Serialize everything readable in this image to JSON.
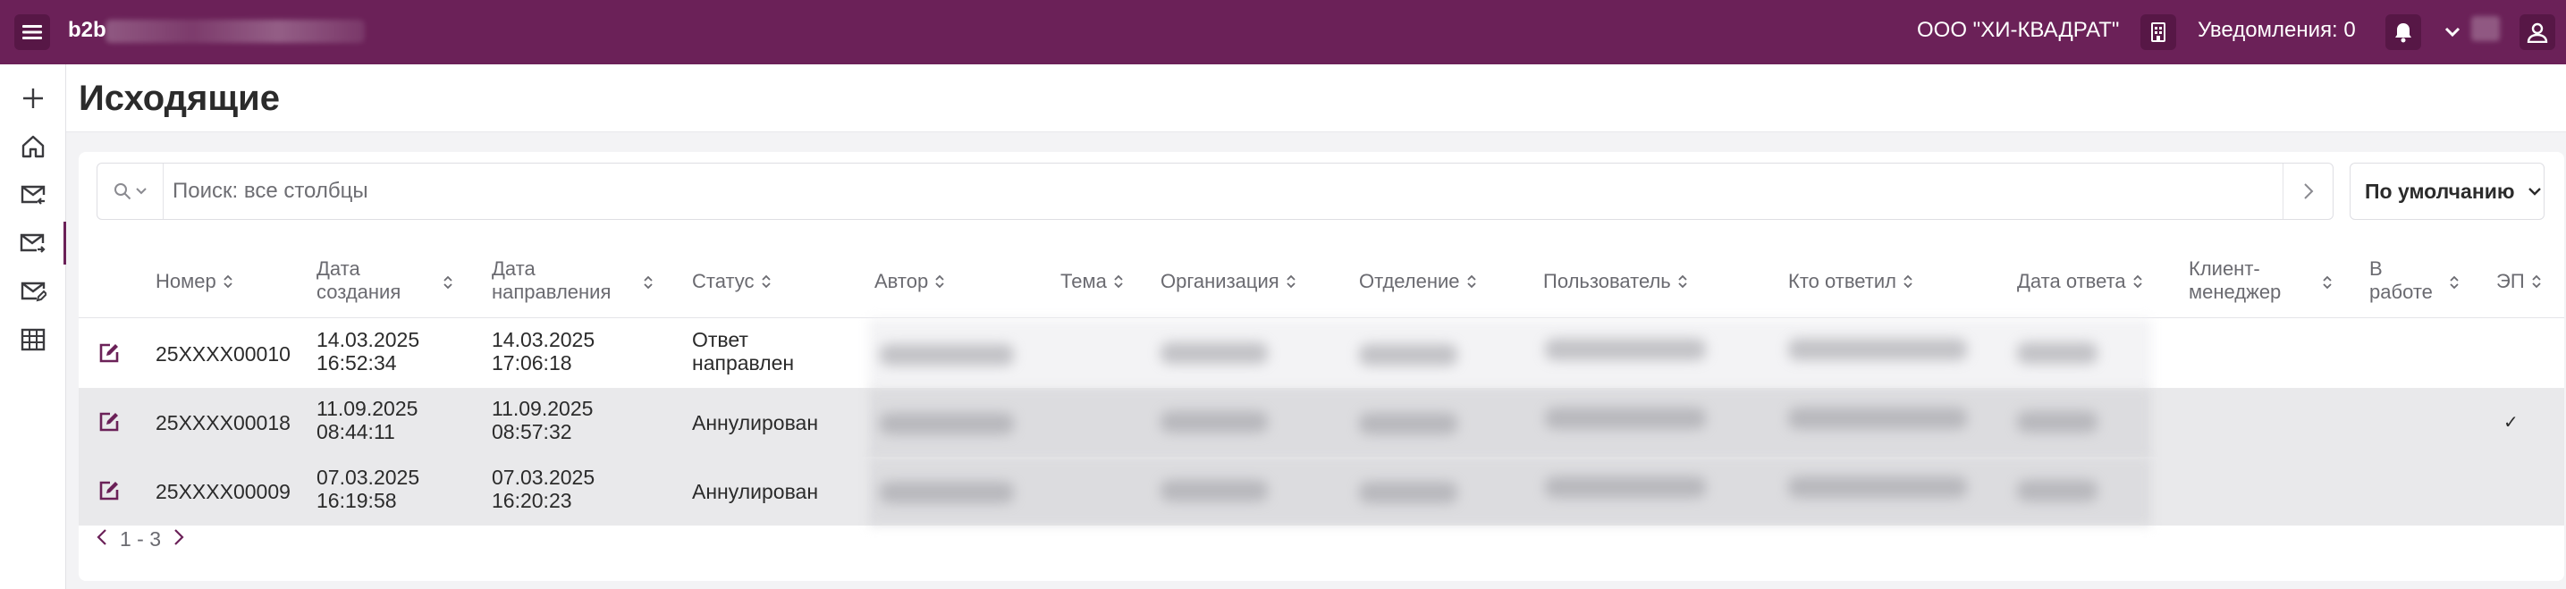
{
  "topbar": {
    "brand": "b2b",
    "org": "ООО \"ХИ-КВАДРАТ\"",
    "notifications_label": "Уведомления: 0",
    "accent_color": "#6b2158"
  },
  "sidebar": {
    "items": [
      {
        "icon": "plus-icon"
      },
      {
        "icon": "home-icon"
      },
      {
        "icon": "inbox-mail-icon"
      },
      {
        "icon": "outbox-mail-icon",
        "active": true
      },
      {
        "icon": "mail-edit-icon"
      },
      {
        "icon": "table-icon"
      }
    ]
  },
  "page": {
    "title": "Исходящие"
  },
  "search": {
    "placeholder": "Поиск: все столбцы",
    "sort_label": "По умолчанию"
  },
  "table": {
    "headers": {
      "number": "Номер",
      "created_1": "Дата",
      "created_2": "создания",
      "sent_1": "Дата",
      "sent_2": "направления",
      "status": "Статус",
      "author": "Автор",
      "topic": "Тема",
      "organization": "Организация",
      "department": "Отделение",
      "user": "Пользователь",
      "responder": "Кто ответил",
      "response_date": "Дата ответа",
      "manager_1": "Клиент-",
      "manager_2": "менеджер",
      "in_work_1": "В",
      "in_work_2": "работе",
      "ep": "ЭП"
    },
    "rows": [
      {
        "number": "25XXXX00010",
        "created_date": "14.03.2025",
        "created_time": "16:52:34",
        "sent_date": "14.03.2025",
        "sent_time": "17:06:18",
        "status_1": "Ответ",
        "status_2": "направлен",
        "ep": ""
      },
      {
        "number": "25XXXX00018",
        "created_date": "11.09.2025",
        "created_time": "08:44:11",
        "sent_date": "11.09.2025",
        "sent_time": "08:57:32",
        "status_1": "Аннулирован",
        "status_2": "",
        "ep": "✓"
      },
      {
        "number": "25XXXX00009",
        "created_date": "07.03.2025",
        "created_time": "16:19:58",
        "sent_date": "07.03.2025",
        "sent_time": "16:20:23",
        "status_1": "Аннулирован",
        "status_2": "",
        "ep": ""
      }
    ]
  },
  "pager": {
    "range": "1 - 3"
  }
}
